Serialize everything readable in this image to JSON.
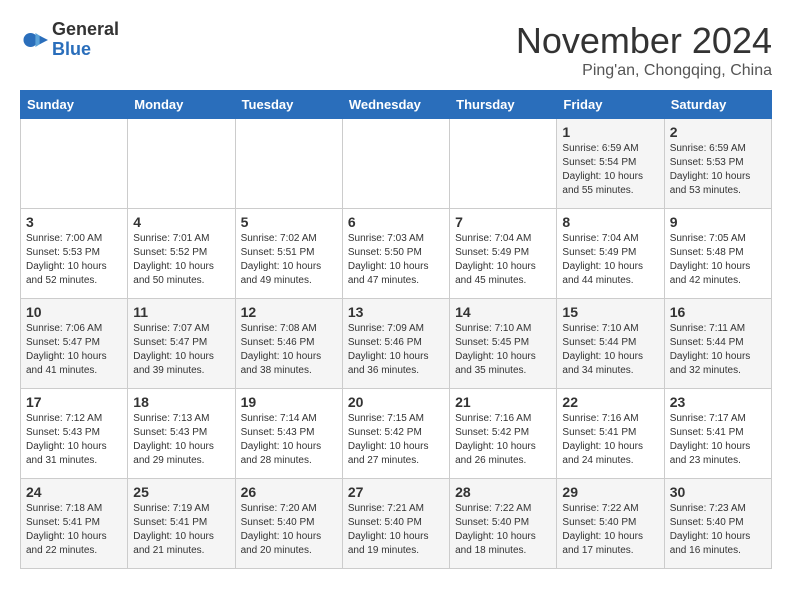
{
  "logo": {
    "general": "General",
    "blue": "Blue"
  },
  "title": "November 2024",
  "location": "Ping'an, Chongqing, China",
  "days_of_week": [
    "Sunday",
    "Monday",
    "Tuesday",
    "Wednesday",
    "Thursday",
    "Friday",
    "Saturday"
  ],
  "weeks": [
    [
      {
        "day": "",
        "info": ""
      },
      {
        "day": "",
        "info": ""
      },
      {
        "day": "",
        "info": ""
      },
      {
        "day": "",
        "info": ""
      },
      {
        "day": "",
        "info": ""
      },
      {
        "day": "1",
        "info": "Sunrise: 6:59 AM\nSunset: 5:54 PM\nDaylight: 10 hours and 55 minutes."
      },
      {
        "day": "2",
        "info": "Sunrise: 6:59 AM\nSunset: 5:53 PM\nDaylight: 10 hours and 53 minutes."
      }
    ],
    [
      {
        "day": "3",
        "info": "Sunrise: 7:00 AM\nSunset: 5:53 PM\nDaylight: 10 hours and 52 minutes."
      },
      {
        "day": "4",
        "info": "Sunrise: 7:01 AM\nSunset: 5:52 PM\nDaylight: 10 hours and 50 minutes."
      },
      {
        "day": "5",
        "info": "Sunrise: 7:02 AM\nSunset: 5:51 PM\nDaylight: 10 hours and 49 minutes."
      },
      {
        "day": "6",
        "info": "Sunrise: 7:03 AM\nSunset: 5:50 PM\nDaylight: 10 hours and 47 minutes."
      },
      {
        "day": "7",
        "info": "Sunrise: 7:04 AM\nSunset: 5:49 PM\nDaylight: 10 hours and 45 minutes."
      },
      {
        "day": "8",
        "info": "Sunrise: 7:04 AM\nSunset: 5:49 PM\nDaylight: 10 hours and 44 minutes."
      },
      {
        "day": "9",
        "info": "Sunrise: 7:05 AM\nSunset: 5:48 PM\nDaylight: 10 hours and 42 minutes."
      }
    ],
    [
      {
        "day": "10",
        "info": "Sunrise: 7:06 AM\nSunset: 5:47 PM\nDaylight: 10 hours and 41 minutes."
      },
      {
        "day": "11",
        "info": "Sunrise: 7:07 AM\nSunset: 5:47 PM\nDaylight: 10 hours and 39 minutes."
      },
      {
        "day": "12",
        "info": "Sunrise: 7:08 AM\nSunset: 5:46 PM\nDaylight: 10 hours and 38 minutes."
      },
      {
        "day": "13",
        "info": "Sunrise: 7:09 AM\nSunset: 5:46 PM\nDaylight: 10 hours and 36 minutes."
      },
      {
        "day": "14",
        "info": "Sunrise: 7:10 AM\nSunset: 5:45 PM\nDaylight: 10 hours and 35 minutes."
      },
      {
        "day": "15",
        "info": "Sunrise: 7:10 AM\nSunset: 5:44 PM\nDaylight: 10 hours and 34 minutes."
      },
      {
        "day": "16",
        "info": "Sunrise: 7:11 AM\nSunset: 5:44 PM\nDaylight: 10 hours and 32 minutes."
      }
    ],
    [
      {
        "day": "17",
        "info": "Sunrise: 7:12 AM\nSunset: 5:43 PM\nDaylight: 10 hours and 31 minutes."
      },
      {
        "day": "18",
        "info": "Sunrise: 7:13 AM\nSunset: 5:43 PM\nDaylight: 10 hours and 29 minutes."
      },
      {
        "day": "19",
        "info": "Sunrise: 7:14 AM\nSunset: 5:43 PM\nDaylight: 10 hours and 28 minutes."
      },
      {
        "day": "20",
        "info": "Sunrise: 7:15 AM\nSunset: 5:42 PM\nDaylight: 10 hours and 27 minutes."
      },
      {
        "day": "21",
        "info": "Sunrise: 7:16 AM\nSunset: 5:42 PM\nDaylight: 10 hours and 26 minutes."
      },
      {
        "day": "22",
        "info": "Sunrise: 7:16 AM\nSunset: 5:41 PM\nDaylight: 10 hours and 24 minutes."
      },
      {
        "day": "23",
        "info": "Sunrise: 7:17 AM\nSunset: 5:41 PM\nDaylight: 10 hours and 23 minutes."
      }
    ],
    [
      {
        "day": "24",
        "info": "Sunrise: 7:18 AM\nSunset: 5:41 PM\nDaylight: 10 hours and 22 minutes."
      },
      {
        "day": "25",
        "info": "Sunrise: 7:19 AM\nSunset: 5:41 PM\nDaylight: 10 hours and 21 minutes."
      },
      {
        "day": "26",
        "info": "Sunrise: 7:20 AM\nSunset: 5:40 PM\nDaylight: 10 hours and 20 minutes."
      },
      {
        "day": "27",
        "info": "Sunrise: 7:21 AM\nSunset: 5:40 PM\nDaylight: 10 hours and 19 minutes."
      },
      {
        "day": "28",
        "info": "Sunrise: 7:22 AM\nSunset: 5:40 PM\nDaylight: 10 hours and 18 minutes."
      },
      {
        "day": "29",
        "info": "Sunrise: 7:22 AM\nSunset: 5:40 PM\nDaylight: 10 hours and 17 minutes."
      },
      {
        "day": "30",
        "info": "Sunrise: 7:23 AM\nSunset: 5:40 PM\nDaylight: 10 hours and 16 minutes."
      }
    ]
  ]
}
